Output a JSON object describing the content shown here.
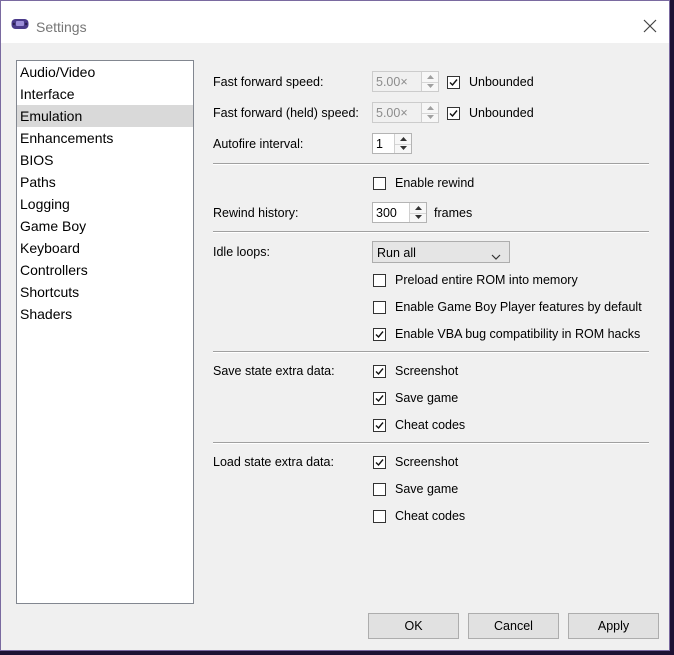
{
  "window": {
    "title": "Settings"
  },
  "sidebar": {
    "items": [
      {
        "label": "Audio/Video"
      },
      {
        "label": "Interface"
      },
      {
        "label": "Emulation"
      },
      {
        "label": "Enhancements"
      },
      {
        "label": "BIOS"
      },
      {
        "label": "Paths"
      },
      {
        "label": "Logging"
      },
      {
        "label": "Game Boy"
      },
      {
        "label": "Keyboard"
      },
      {
        "label": "Controllers"
      },
      {
        "label": "Shortcuts"
      },
      {
        "label": "Shaders"
      }
    ],
    "selected": "Emulation"
  },
  "emulation": {
    "fast_forward_speed": {
      "label": "Fast forward speed:",
      "value": "5.00×",
      "unbounded_label": "Unbounded",
      "unbounded": true
    },
    "fast_forward_held_speed": {
      "label": "Fast forward (held) speed:",
      "value": "5.00×",
      "unbounded_label": "Unbounded",
      "unbounded": true
    },
    "autofire_interval": {
      "label": "Autofire interval:",
      "value": "1"
    },
    "enable_rewind": {
      "label": "Enable rewind",
      "checked": false
    },
    "rewind_history": {
      "label": "Rewind history:",
      "value": "300",
      "unit": "frames"
    },
    "idle_loops": {
      "label": "Idle loops:",
      "value": "Run all"
    },
    "preload_rom": {
      "label": "Preload entire ROM into memory",
      "checked": false
    },
    "gb_player": {
      "label": "Enable Game Boy Player features by default",
      "checked": false
    },
    "vba_bug": {
      "label": "Enable VBA bug compatibility in ROM hacks",
      "checked": true
    },
    "save_state": {
      "label": "Save state extra data:",
      "screenshot": {
        "label": "Screenshot",
        "checked": true
      },
      "save_game": {
        "label": "Save game",
        "checked": true
      },
      "cheat_codes": {
        "label": "Cheat codes",
        "checked": true
      }
    },
    "load_state": {
      "label": "Load state extra data:",
      "screenshot": {
        "label": "Screenshot",
        "checked": true
      },
      "save_game": {
        "label": "Save game",
        "checked": false
      },
      "cheat_codes": {
        "label": "Cheat codes",
        "checked": false
      }
    }
  },
  "buttons": {
    "ok": "OK",
    "cancel": "Cancel",
    "apply": "Apply"
  },
  "colors": {
    "window_bg": "#f0f0f0",
    "desktop_bg": "#1c1233",
    "selected_item": "#d9d9d9"
  },
  "icons": {
    "app": "gamepad-icon",
    "close": "close-icon",
    "spin_up": "arrow-up-icon",
    "spin_down": "arrow-down-icon",
    "combo": "chevron-down-icon",
    "check": "check-icon"
  }
}
